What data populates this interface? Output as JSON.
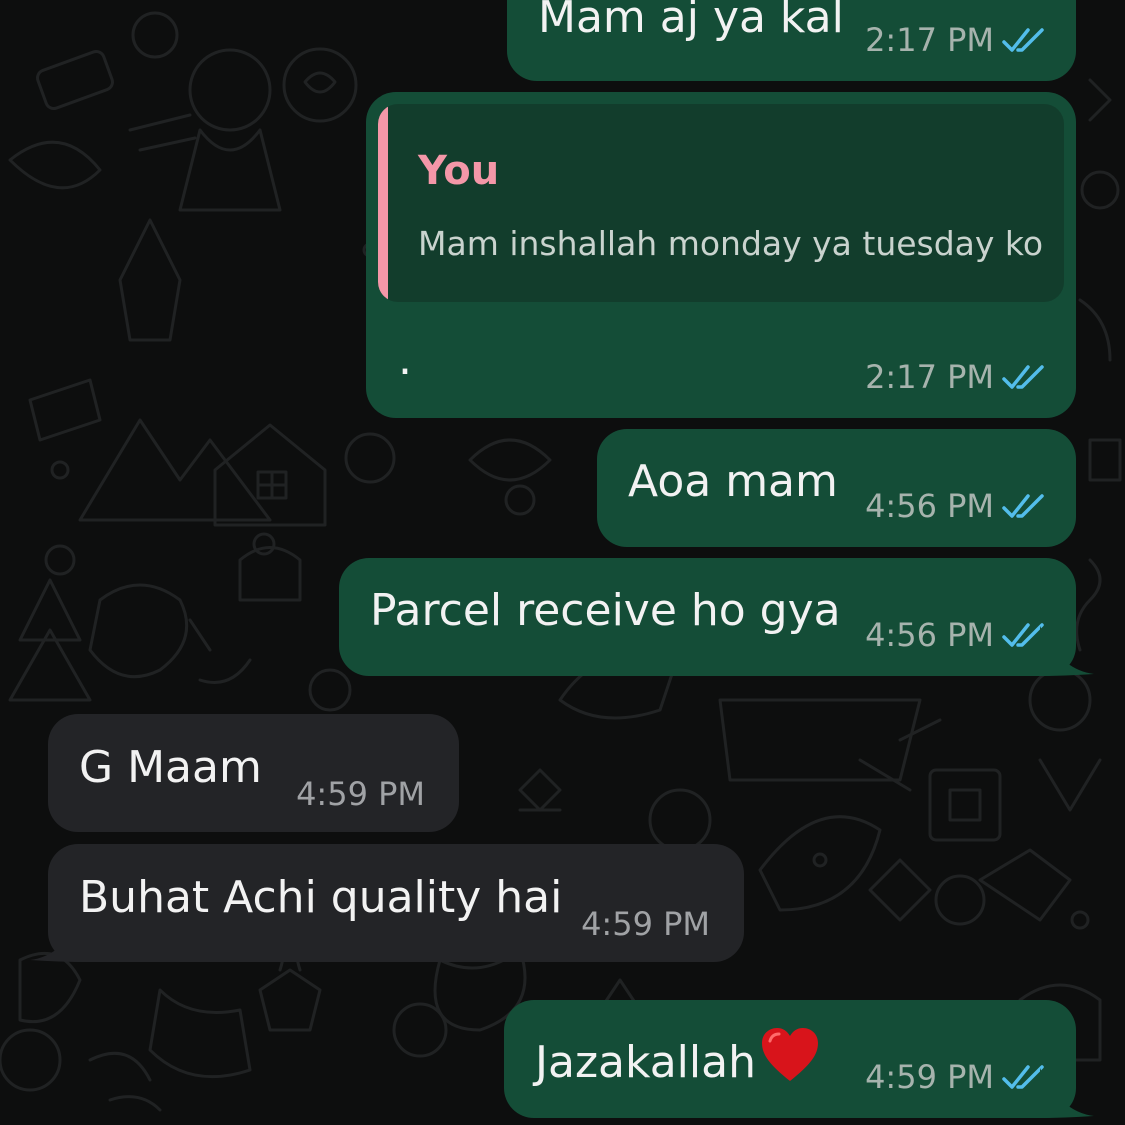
{
  "conversation": {
    "messages": [
      {
        "direction": "outgoing",
        "text": "Mam aj ya kal",
        "time": "2:17 PM",
        "status": "read"
      },
      {
        "direction": "outgoing",
        "text": ".",
        "time": "2:17 PM",
        "status": "read",
        "reply_to": {
          "author": "You",
          "text": "Mam inshallah monday ya tuesday ko"
        }
      },
      {
        "direction": "outgoing",
        "text": "Aoa mam",
        "time": "4:56 PM",
        "status": "read"
      },
      {
        "direction": "outgoing",
        "text": "Parcel receive ho gya",
        "time": "4:56 PM",
        "status": "read"
      },
      {
        "direction": "incoming",
        "text": "G Maam",
        "time": "4:59 PM"
      },
      {
        "direction": "incoming",
        "text": "Buhat Achi quality hai",
        "time": "4:59 PM"
      },
      {
        "direction": "outgoing",
        "text": "Jazakallah",
        "emoji": "red-heart",
        "time": "4:59 PM",
        "status": "read"
      }
    ]
  },
  "colors": {
    "outgoing_bubble": "#144d37",
    "incoming_bubble": "#232427",
    "quote_accent": "#f497a8",
    "read_ticks": "#53bdeb",
    "wallpaper": "#0d0e0e"
  },
  "icons": {
    "read_receipt": "double-check-icon",
    "emoji": "red-heart-icon"
  }
}
